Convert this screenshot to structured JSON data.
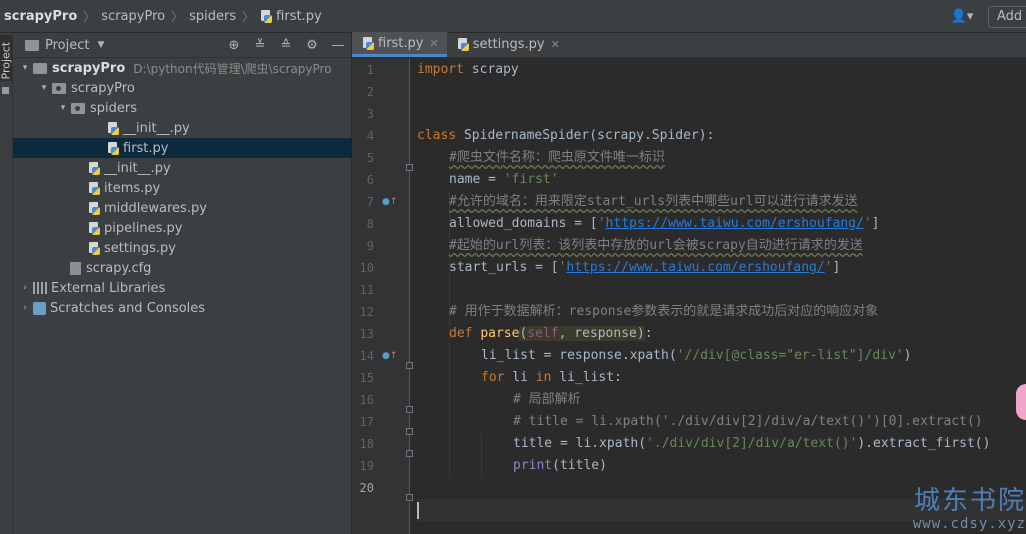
{
  "breadcrumbs": [
    "scrapyPro",
    "scrapyPro",
    "spiders",
    "first.py"
  ],
  "topbar": {
    "add_label": "Add C"
  },
  "sidebar_tab": "Project",
  "project_panel": {
    "title": "Project",
    "tree": [
      {
        "label": "scrapyPro",
        "hint": "D:\\python代码管理\\爬虫\\scrapyPro",
        "indent": 0,
        "arrow": "▾",
        "icon": "folder"
      },
      {
        "label": "scrapyPro",
        "indent": 1,
        "arrow": "▾",
        "icon": "package"
      },
      {
        "label": "spiders",
        "indent": 2,
        "arrow": "▾",
        "icon": "package"
      },
      {
        "label": "__init__.py",
        "indent": 4,
        "arrow": "",
        "icon": "python"
      },
      {
        "label": "first.py",
        "indent": 4,
        "arrow": "",
        "icon": "python",
        "selected": true
      },
      {
        "label": "__init__.py",
        "indent": 3,
        "arrow": "",
        "icon": "python"
      },
      {
        "label": "items.py",
        "indent": 3,
        "arrow": "",
        "icon": "python"
      },
      {
        "label": "middlewares.py",
        "indent": 3,
        "arrow": "",
        "icon": "python"
      },
      {
        "label": "pipelines.py",
        "indent": 3,
        "arrow": "",
        "icon": "python"
      },
      {
        "label": "settings.py",
        "indent": 3,
        "arrow": "",
        "icon": "python"
      },
      {
        "label": "scrapy.cfg",
        "indent": 2,
        "arrow": "",
        "icon": "config"
      },
      {
        "label": "External Libraries",
        "indent": 0,
        "arrow": "›",
        "icon": "library"
      },
      {
        "label": "Scratches and Consoles",
        "indent": 0,
        "arrow": "›",
        "icon": "scratches"
      }
    ]
  },
  "editor_tabs": [
    {
      "label": "first.py",
      "active": true
    },
    {
      "label": "settings.py",
      "active": false
    }
  ],
  "line_numbers": [
    "1",
    "2",
    "3",
    "4",
    "5",
    "6",
    "7",
    "8",
    "9",
    "10",
    "11",
    "12",
    "13",
    "14",
    "15",
    "16",
    "17",
    "18",
    "19",
    "20"
  ],
  "code": {
    "l1_kw": "import",
    "l1_mod": " scrapy",
    "l4_kw": "class",
    "l4_rest": " SpidernameSpider(scrapy.Spider):",
    "l5": "#爬虫文件名称：爬虫原文件唯一标识",
    "l6_name": "name = ",
    "l6_str": "'first'",
    "l7": "#允许的域名：用来限定start_urls列表中哪些url可以进行请求发送",
    "l8_a": "allowed_domains = [",
    "l8_q1": "'",
    "l8_url": "https://www.taiwu.com/ershoufang/",
    "l8_q2": "'",
    "l8_b": "]",
    "l9": "#起始的url列表：该列表中存放的url会被scrapy自动进行请求的发送",
    "l10_a": "start_urls = [",
    "l10_q1": "'",
    "l10_url": "https://www.taiwu.com/ershoufang/",
    "l10_q2": "'",
    "l10_b": "]",
    "l12": "# 用作于数据解析：response参数表示的就是请求成功后对应的响应对象",
    "l13_kw": "def",
    "l13_fn": "parse",
    "l13_p1": "(",
    "l13_self": "self",
    "l13_p2": ", response)",
    "l13_end": ":",
    "l14_a": "li_list = response.xpath(",
    "l14_str": "'//div[@class=\"er-list\"]/div'",
    "l14_b": ")",
    "l15_kw1": "for",
    "l15_a": " li ",
    "l15_kw2": "in",
    "l15_b": " li_list:",
    "l16": "# 局部解析",
    "l17": "# title = li.xpath('./div/div[2]/div/a/text()')[0].extract()",
    "l18_a": "title = li.xpath(",
    "l18_str": "'./div/div[2]/div/a/text()'",
    "l18_b": ").extract_first()",
    "l19_fn": "print",
    "l19_b": "(title)"
  },
  "watermark": {
    "title": "城东书院",
    "url": "www.cdsy.xyz"
  },
  "colors": {
    "keyword": "#cc7832",
    "string": "#6a8759",
    "comment": "#808080",
    "link": "#287bde",
    "selection": "#0d293e"
  }
}
